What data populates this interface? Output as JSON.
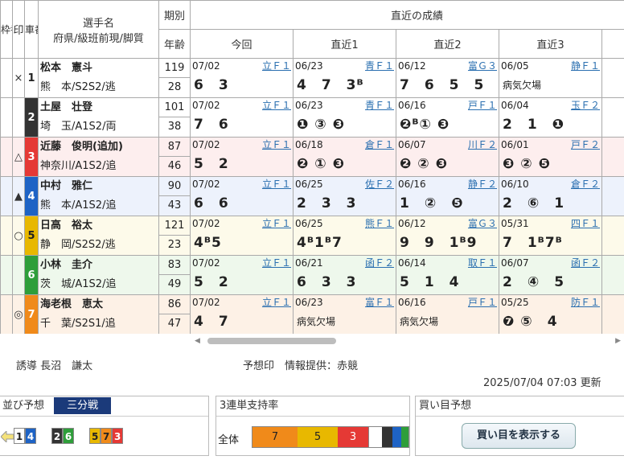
{
  "headers": {
    "waku": "枠番",
    "mark": "印",
    "car": "車番",
    "name1": "選手名",
    "name2": "府県/級班前現/脚質",
    "term": "期別",
    "age": "年齢",
    "recent": "直近の成績",
    "cols": [
      "今回",
      "直近1",
      "直近2",
      "直近3"
    ]
  },
  "riders": [
    {
      "waku": "",
      "mark": "×",
      "car": "1",
      "color": "#ffffff",
      "fg": "#222",
      "bg": "#ffffff",
      "name": "松本　憲斗",
      "pref": "熊　本/S2S2/逃",
      "term": "119",
      "age": "28",
      "results": [
        {
          "date": "07/02",
          "venue": "立Ｆ１",
          "rank": "6　3"
        },
        {
          "date": "06/23",
          "venue": "青Ｆ１",
          "rank": "4　7　3ᴮ"
        },
        {
          "date": "06/12",
          "venue": "富Ｇ３",
          "rank": "7　6　5　5"
        },
        {
          "date": "06/05",
          "venue": "静Ｆ１",
          "rank": "病気欠場",
          "small": true
        }
      ]
    },
    {
      "waku": "",
      "mark": "",
      "car": "2",
      "color": "#333333",
      "fg": "#fff",
      "bg": "#ffffff",
      "name": "土屋　壮登",
      "pref": "埼　玉/A1S2/両",
      "term": "101",
      "age": "38",
      "results": [
        {
          "date": "07/02",
          "venue": "立Ｆ１",
          "rank": "7　6"
        },
        {
          "date": "06/23",
          "venue": "青Ｆ１",
          "rank": "❶ ③ ❸"
        },
        {
          "date": "06/16",
          "venue": "戸Ｆ１",
          "rank": "❷ᴮ① ❸"
        },
        {
          "date": "06/04",
          "venue": "玉Ｆ２",
          "rank": "2　1　❶"
        }
      ]
    },
    {
      "waku": "",
      "mark": "△",
      "car": "3",
      "color": "#e53935",
      "fg": "#fff",
      "bg": "#fdeeee",
      "name": "近藤　俊明(追加)",
      "pref": "神奈川/A1S2/追",
      "term": "87",
      "age": "46",
      "results": [
        {
          "date": "07/02",
          "venue": "立Ｆ１",
          "rank": "5　2"
        },
        {
          "date": "06/18",
          "venue": "倉Ｆ１",
          "rank": "❷ ① ❸"
        },
        {
          "date": "06/07",
          "venue": "川Ｆ２",
          "rank": "❷ ② ❸"
        },
        {
          "date": "06/01",
          "venue": "戸Ｆ２",
          "rank": "❸ ② ❺"
        }
      ]
    },
    {
      "waku": "",
      "mark": "▲",
      "car": "4",
      "color": "#1e63c5",
      "fg": "#fff",
      "bg": "#edf2fc",
      "name": "中村　雅仁",
      "pref": "熊　本/A1S2/追",
      "term": "90",
      "age": "43",
      "results": [
        {
          "date": "07/02",
          "venue": "立Ｆ１",
          "rank": "6　6"
        },
        {
          "date": "06/25",
          "venue": "佐Ｆ２",
          "rank": "2　3　3"
        },
        {
          "date": "06/16",
          "venue": "静Ｆ２",
          "rank": "1　②　❺"
        },
        {
          "date": "06/10",
          "venue": "倉Ｆ２",
          "rank": "2　⑥　1"
        }
      ]
    },
    {
      "waku": "",
      "mark": "○",
      "car": "5",
      "color": "#e8b800",
      "fg": "#222",
      "bg": "#fdfaea",
      "name": "日高　裕太",
      "pref": "静　岡/S2S2/逃",
      "term": "121",
      "age": "23",
      "results": [
        {
          "date": "07/02",
          "venue": "立Ｆ１",
          "rank": "4ᴮ5"
        },
        {
          "date": "06/25",
          "venue": "熊Ｆ１",
          "rank": "4ᴮ1ᴮ7"
        },
        {
          "date": "06/12",
          "venue": "富Ｇ３",
          "rank": "9　9　1ᴮ9"
        },
        {
          "date": "05/31",
          "venue": "四Ｆ１",
          "rank": "7　1ᴮ7ᴮ"
        }
      ]
    },
    {
      "waku": "",
      "mark": "",
      "car": "6",
      "color": "#2e9e3a",
      "fg": "#fff",
      "bg": "#eef8ec",
      "name": "小林　圭介",
      "pref": "茨　城/A1S2/追",
      "term": "83",
      "age": "49",
      "results": [
        {
          "date": "07/02",
          "venue": "立Ｆ１",
          "rank": "5　2"
        },
        {
          "date": "06/21",
          "venue": "函Ｆ２",
          "rank": "6　3　3"
        },
        {
          "date": "06/14",
          "venue": "取Ｆ１",
          "rank": "5　1　4"
        },
        {
          "date": "06/07",
          "venue": "函Ｆ２",
          "rank": "2　④　5"
        }
      ]
    },
    {
      "waku": "",
      "mark": "◎",
      "car": "7",
      "color": "#f08a1a",
      "fg": "#fff",
      "bg": "#fdf1e6",
      "name": "海老根　恵太",
      "pref": "千　葉/S2S1/追",
      "term": "86",
      "age": "47",
      "results": [
        {
          "date": "07/02",
          "venue": "立Ｆ１",
          "rank": "4　7"
        },
        {
          "date": "06/23",
          "venue": "富Ｆ１",
          "rank": "病気欠場",
          "small": true
        },
        {
          "date": "06/16",
          "venue": "戸Ｆ１",
          "rank": "病気欠場",
          "small": true
        },
        {
          "date": "05/25",
          "venue": "防Ｆ１",
          "rank": "❼ ⑤　4"
        }
      ]
    }
  ],
  "footer": {
    "guide": "誘導 長沼　謙太",
    "prediction": "予想印　情報提供：赤競",
    "updated": "2025/07/04 07:03 更新"
  },
  "panels": {
    "line_title": "並び予想",
    "line_badge": "三分戦",
    "support_title": "3連単支持率",
    "support_label": "全体",
    "buy_title": "買い目予想",
    "buy_button": "買い目を表示する"
  },
  "support": [
    {
      "label": "7",
      "color": "#f08a1a"
    },
    {
      "label": "5",
      "color": "#e8b800"
    },
    {
      "label": "3",
      "color": "#e53935"
    }
  ]
}
